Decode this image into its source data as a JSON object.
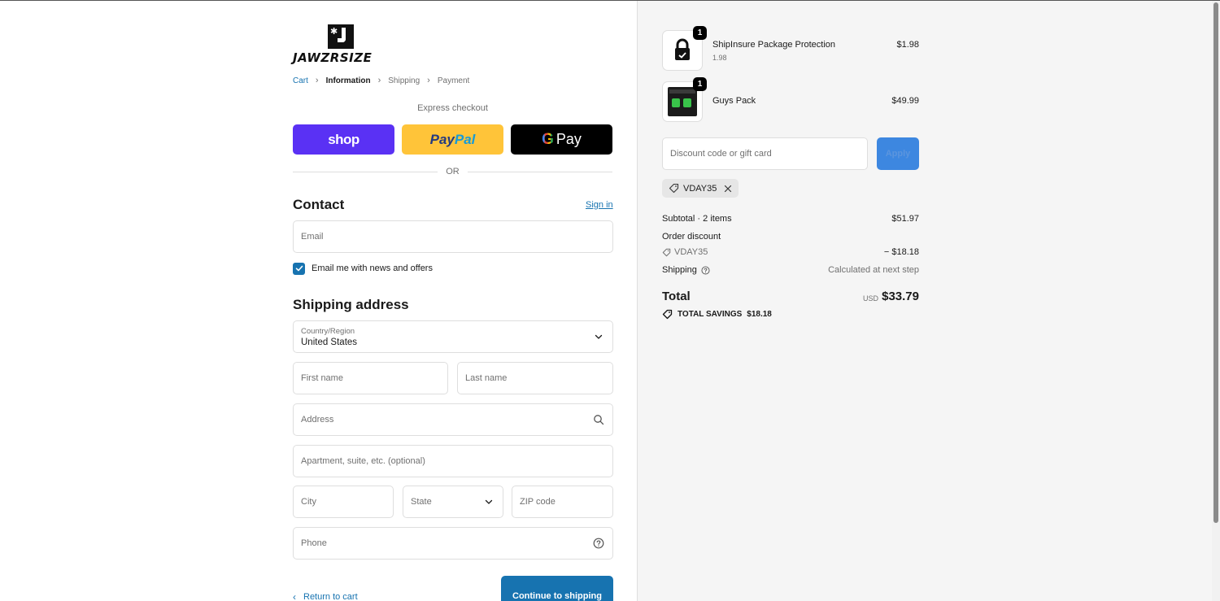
{
  "brand": {
    "name": "JAWZRSIZE"
  },
  "breadcrumb": [
    {
      "label": "Cart",
      "state": "link"
    },
    {
      "label": "Information",
      "state": "active"
    },
    {
      "label": "Shipping",
      "state": "inactive"
    },
    {
      "label": "Payment",
      "state": "inactive"
    }
  ],
  "express": {
    "label": "Express checkout",
    "shop_label": "shop",
    "paypal_label_a": "Pay",
    "paypal_label_b": "Pal",
    "gpay_g": "G",
    "gpay_label": "Pay",
    "or_label": "OR"
  },
  "contact": {
    "title": "Contact",
    "sign_in": "Sign in",
    "email_placeholder": "Email",
    "newsletter_label": "Email me with news and offers",
    "newsletter_checked": true
  },
  "shipping": {
    "title": "Shipping address",
    "country_label": "Country/Region",
    "country_value": "United States",
    "first_name": "First name",
    "last_name": "Last name",
    "address": "Address",
    "apartment": "Apartment, suite, etc. (optional)",
    "city": "City",
    "state": "State",
    "zip": "ZIP code",
    "phone": "Phone"
  },
  "footer": {
    "return_label": "Return to cart",
    "continue_label": "Continue to shipping"
  },
  "summary": {
    "items": [
      {
        "name": "ShipInsure Package Protection",
        "sub": "1.98",
        "price": "$1.98",
        "qty": "1",
        "icon": "lock-icon"
      },
      {
        "name": "Guys Pack",
        "sub": "",
        "price": "$49.99",
        "qty": "1",
        "icon": "product-box-image"
      }
    ],
    "discount_placeholder": "Discount code or gift card",
    "apply_label": "Apply",
    "applied_code": "VDAY35",
    "subtotal_label": "Subtotal · 2 items",
    "subtotal_value": "$51.97",
    "order_discount_label": "Order discount",
    "discount_code": "VDAY35",
    "discount_value": "− $18.18",
    "shipping_label": "Shipping",
    "shipping_value": "Calculated at next step",
    "total_label": "Total",
    "total_currency": "USD",
    "total_value": "$33.79",
    "savings_label": "TOTAL SAVINGS",
    "savings_value": "$18.18"
  },
  "colors": {
    "link": "#1773b0",
    "shop": "#5a31f4",
    "paypal": "#ffc439",
    "gpay": "#000000",
    "summary_bg": "#f5f5f5"
  }
}
